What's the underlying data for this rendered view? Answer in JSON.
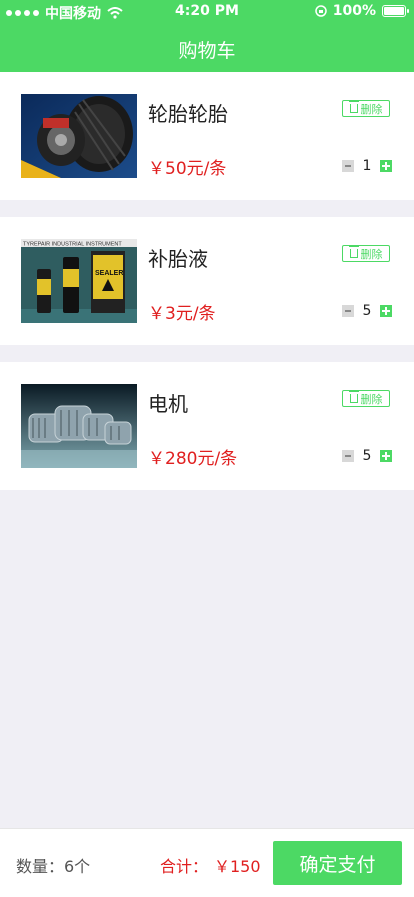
{
  "status_bar": {
    "carrier": "中国移动",
    "time": "4:20 PM",
    "battery": "100%"
  },
  "header": {
    "title": "购物车"
  },
  "items": [
    {
      "name": "轮胎轮胎",
      "price": "￥50元/条",
      "quantity": "1",
      "delete_label": "删除"
    },
    {
      "name": "补胎液",
      "price": "￥3元/条",
      "quantity": "5",
      "delete_label": "删除",
      "image_text": "TYREPAIR INDUSTRIAL INSTRUMENT",
      "product_label": "SEALER"
    },
    {
      "name": "电机",
      "price": "￥280元/条",
      "quantity": "5",
      "delete_label": "删除"
    }
  ],
  "footer": {
    "count": "数量：6个",
    "total_label": "合计：",
    "total_value": "￥150",
    "pay_button": "确定支付"
  },
  "colors": {
    "accent": "#4cd964",
    "price": "#e02020",
    "background": "#f0eff5"
  }
}
